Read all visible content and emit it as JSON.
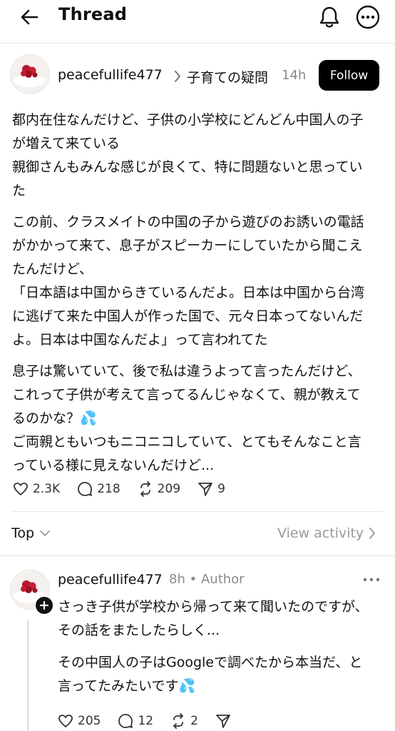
{
  "header": {
    "back_icon": "arrow-left-icon",
    "title": "Thread",
    "bell_icon": "bell-icon",
    "more_icon": "more-circle-icon"
  },
  "post": {
    "username": "peacefullife477",
    "chevron": ">",
    "community": "子育ての疑問",
    "time": "14h",
    "follow_label": "Follow",
    "paragraphs": [
      "都内在住なんだけど、子供の小学校にどんどん中国人の子が増えて来ている\n親御さんもみんな感じが良くて、特に問題ないと思っていた",
      "この前、クラスメイトの中国の子から遊びのお誘いの電話がかかって来て、息子がスピーカーにしていたから聞こえたんだけど、\n「日本語は中国からきているんだよ。日本は中国から台湾に逃げて来た中国人が作った国で、元々日本ってないんだよ。日本は中国なんだよ」って言われてた",
      "息子は驚いていて、後で私は違うよって言ったんだけど、これって子供が考えて言ってるんじゃなくて、親が教えてるのかな？💦\nご両親ともいつもニコニコしていて、とてもそんなこと言っている様に見えないんだけど..."
    ],
    "likes": "2.3K",
    "comments": "218",
    "reposts": "209",
    "shares": "9"
  },
  "activity_bar": {
    "sort_label": "Top",
    "view_activity_label": "View activity"
  },
  "reply": {
    "username": "peacefullife477",
    "time": "8h",
    "separator": "•",
    "author_badge": "Author",
    "paragraphs": [
      "さっき子供が学校から帰って来て聞いたのですが、その話をまたしたらしく...",
      "その中国人の子はGoogleで調べたから本当だ、と言ってたみたいです💦"
    ],
    "likes": "205",
    "comments": "12",
    "reposts": "2"
  }
}
